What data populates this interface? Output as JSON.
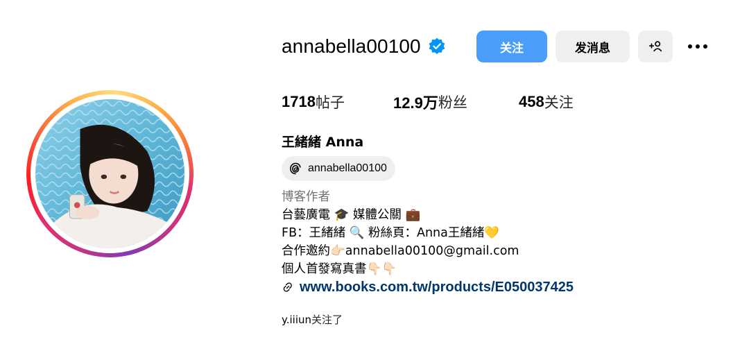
{
  "profile": {
    "username": "annabella00100",
    "verified_icon": "verified-badge-icon",
    "accent_color": "#4a9df8"
  },
  "actions": {
    "follow_label": "关注",
    "message_label": "发消息",
    "add_user_label": "+",
    "more_icon": "more-horizontal-icon"
  },
  "stats": {
    "posts_count": "1718",
    "posts_label": "帖子",
    "followers_count": "12.9万",
    "followers_label": "粉丝",
    "following_count": "458",
    "following_label": "关注"
  },
  "bio": {
    "full_name": "王緒緒 Anna",
    "threads_handle": "annabella00100",
    "category": "博客作者",
    "lines": [
      "台藝廣電 🎓 媒體公關 💼",
      "FB：王緒緒 🔍 粉絲頁：Anna王緒緒💛",
      "合作邀約👉🏻annabella00100@gmail.com",
      "個人首發寫真書👇🏻👇🏻"
    ],
    "link": "www.books.com.tw/products/E050037425"
  },
  "followed_by": {
    "who": "y.iiiun",
    "suffix": "关注了"
  }
}
